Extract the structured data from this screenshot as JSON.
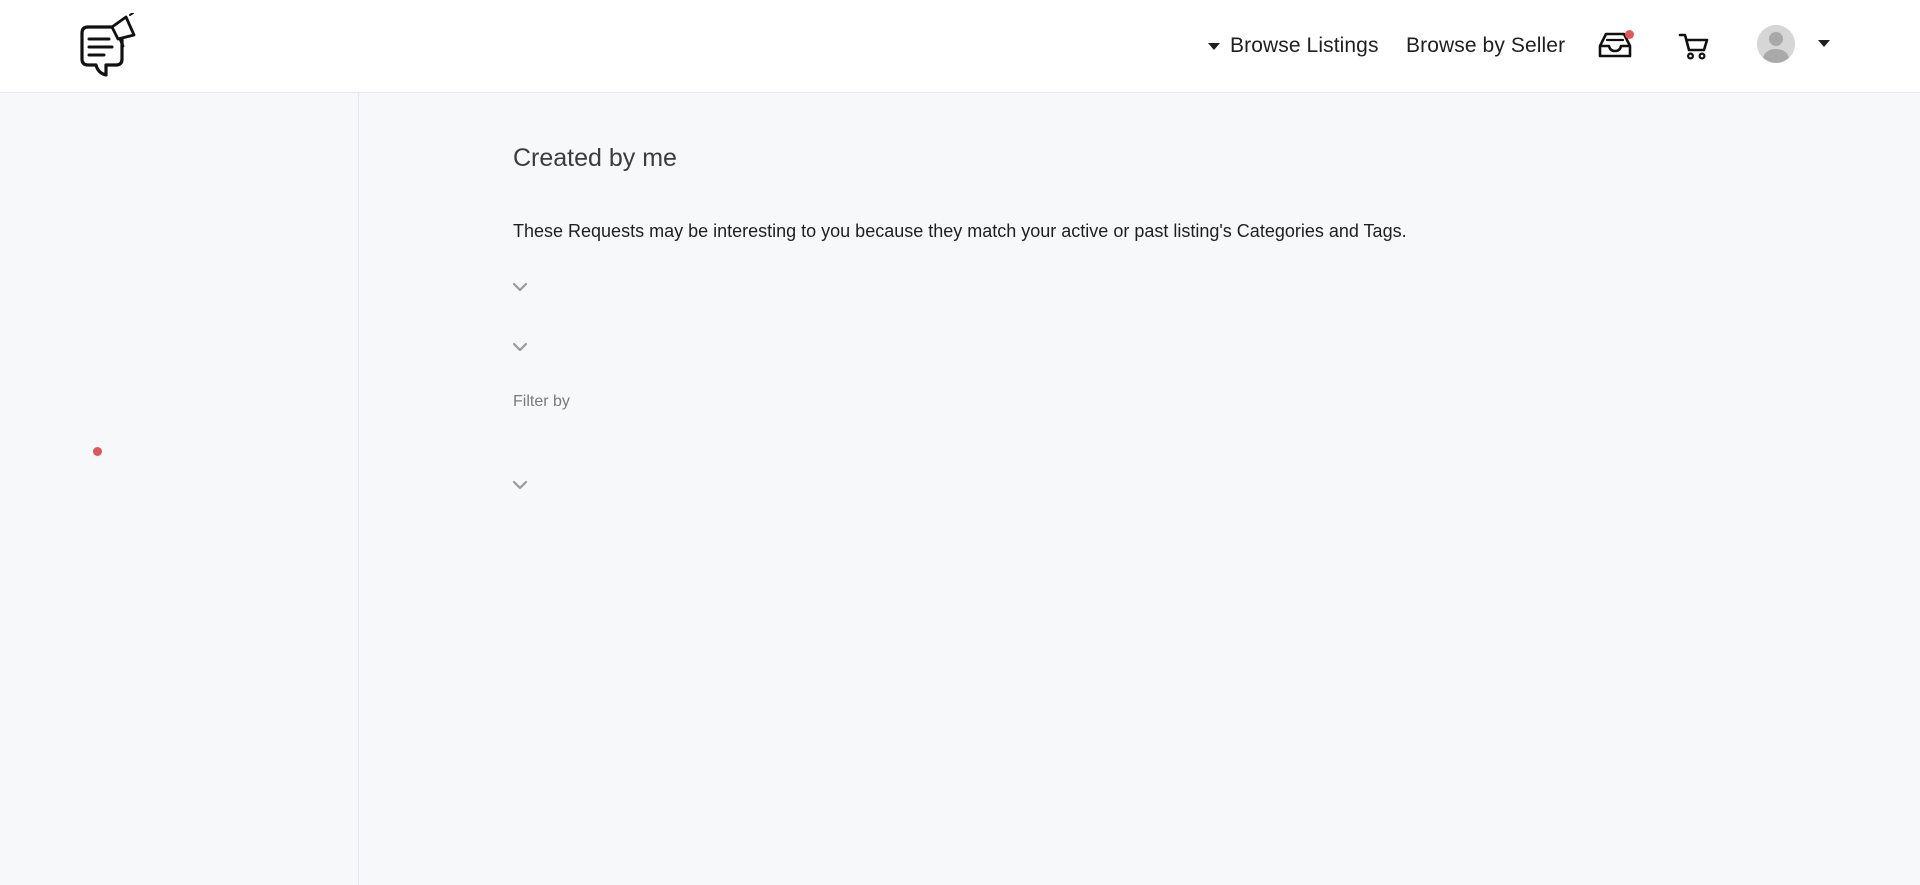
{
  "header": {
    "nav": {
      "browse_listings": "Browse Listings",
      "browse_by_seller": "Browse by Seller"
    },
    "icons": [
      "logo-icon",
      "inbox-icon",
      "cart-icon",
      "avatar",
      "caret-down-icon"
    ],
    "badge_color": "#e0565b"
  },
  "main": {
    "title": "Created by me",
    "intro": "These Requests may be interesting to you because they match your active or past listing's Categories and Tags.",
    "filter_label": "Filter by"
  },
  "colors": {
    "background": "#f7f8f9",
    "header_bg": "#ffffff",
    "notification": "#e0565b",
    "text": "#1f1f1f",
    "muted": "#7a7a7a"
  }
}
